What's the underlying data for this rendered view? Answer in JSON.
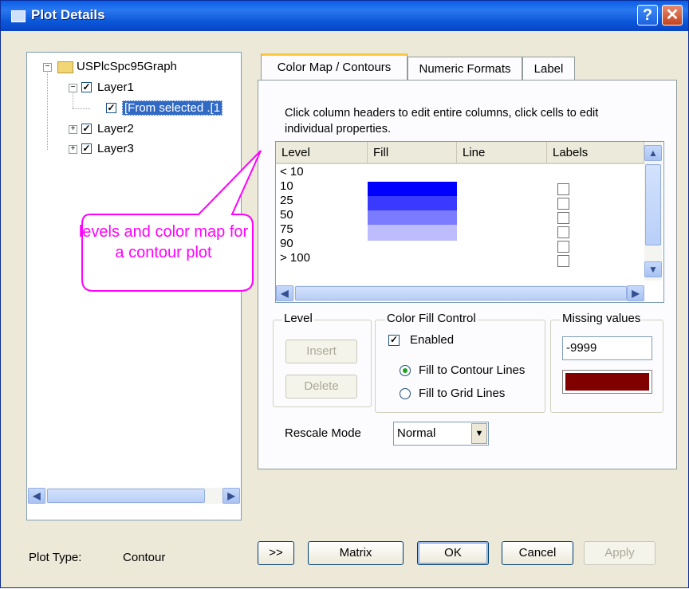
{
  "window": {
    "title": "Plot Details"
  },
  "tree": {
    "root": "USPlcSpc95Graph",
    "layer1": "Layer1",
    "selected_plot": "[From selected .[1",
    "layer2": "Layer2",
    "layer3": "Layer3"
  },
  "tabs": [
    "Color Map / Contours",
    "Numeric Formats",
    "Label"
  ],
  "hint": "Click column headers to edit entire columns, click cells to edit individual properties.",
  "grid": {
    "headers": [
      "Level",
      "Fill",
      "Line",
      "Labels"
    ],
    "rows": [
      {
        "level": "< 10",
        "fill": null,
        "label_checkbox": false
      },
      {
        "level": "10",
        "fill": "#0000ff",
        "label_checkbox": true
      },
      {
        "level": "25",
        "fill": "#3a3aff",
        "label_checkbox": true
      },
      {
        "level": "50",
        "fill": "#7b7bff",
        "label_checkbox": true
      },
      {
        "level": "75",
        "fill": "#bcbcff",
        "label_checkbox": true
      },
      {
        "level": "90",
        "fill": null,
        "label_checkbox": true
      },
      {
        "level": "> 100",
        "fill": null,
        "label_checkbox": true
      }
    ]
  },
  "level_group": {
    "label": "Level",
    "insert": "Insert",
    "delete": "Delete"
  },
  "color_fill": {
    "label": "Color Fill Control",
    "enabled_label": "Enabled",
    "enabled": true,
    "fill_contour": "Fill to Contour Lines",
    "fill_grid": "Fill to Grid Lines",
    "selected": "Fill to Contour Lines"
  },
  "missing": {
    "label": "Missing values",
    "value": "-9999",
    "color": "#800000"
  },
  "rescale": {
    "label": "Rescale Mode",
    "value": "Normal"
  },
  "callout": {
    "text": "levels and color map for a contour plot",
    "color": "#ff00ff"
  },
  "footer": {
    "plot_type_label": "Plot Type:",
    "plot_type_value": "Contour",
    "expand": ">>",
    "matrix": "Matrix",
    "ok": "OK",
    "cancel": "Cancel",
    "apply": "Apply"
  }
}
